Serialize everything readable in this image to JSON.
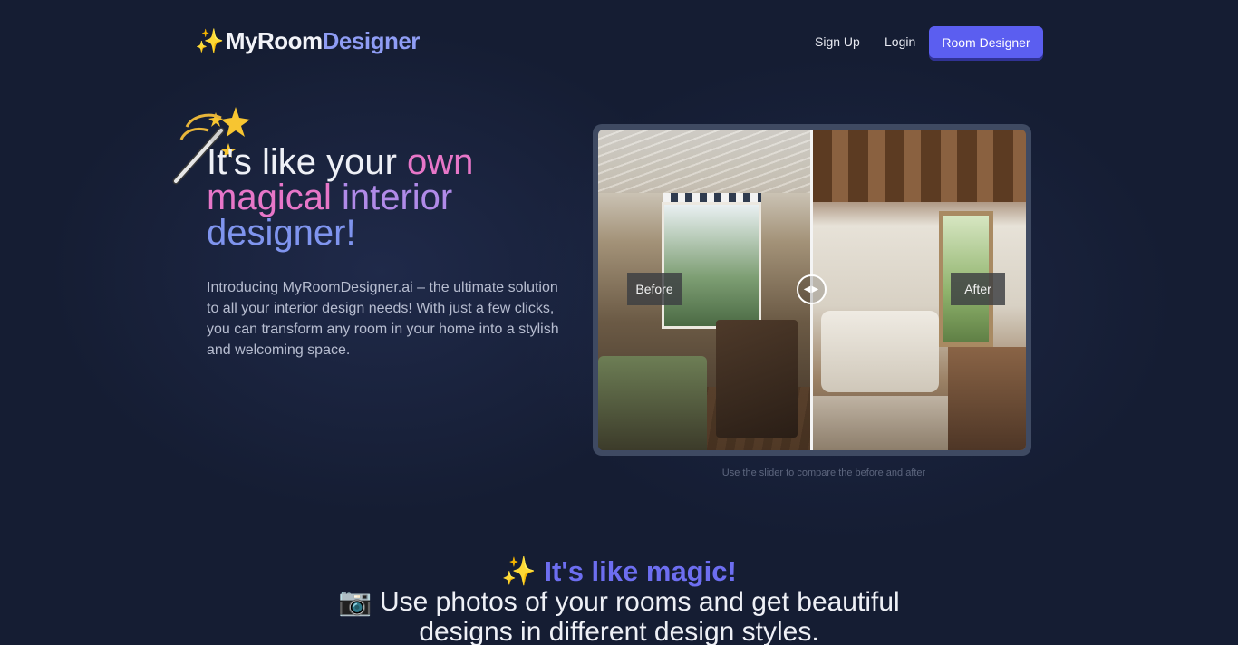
{
  "header": {
    "logo_emoji": "✨",
    "logo_part1": "MyRoom",
    "logo_part2": "Designer",
    "nav_signup": "Sign Up",
    "nav_login": "Login",
    "cta_label": "Room Designer"
  },
  "hero": {
    "wand_icon": "magic-wand-icon",
    "title_part1": "It's like your ",
    "title_part2": "own",
    "title_part3": "magical",
    "title_part4": "interior",
    "title_part5": "designer!",
    "description": "Introducing MyRoomDesigner.ai – the ultimate solution to all your interior design needs! With just a few clicks, you can transform any room in your home into a stylish and welcoming space."
  },
  "compare": {
    "before_label": "Before",
    "after_label": "After",
    "slider_position": 0.5,
    "hint": "Use the slider to compare the before and after"
  },
  "section": {
    "title": "✨ It's like magic!",
    "subtitle": "📷 Use photos of your rooms and get beautiful designs in different design styles."
  },
  "colors": {
    "background": "#151d33",
    "accent": "#5b5ef0",
    "pink": "#e776c8",
    "blue": "#7f94ee"
  }
}
